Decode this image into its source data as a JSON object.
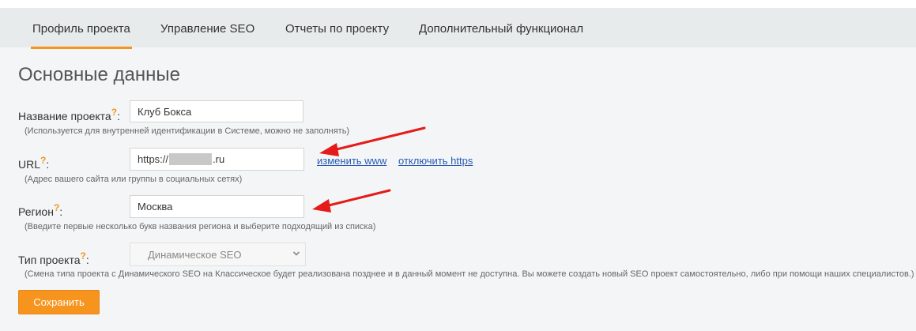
{
  "tabs": [
    {
      "label": "Профиль проекта",
      "active": true
    },
    {
      "label": "Управление SEO",
      "active": false
    },
    {
      "label": "Отчеты по проекту",
      "active": false
    },
    {
      "label": "Дополнительный функционал",
      "active": false
    }
  ],
  "section_title": "Основные данные",
  "help_mark": "?",
  "form": {
    "name": {
      "label": "Название проекта",
      "value": "Клуб Бокса",
      "hint": "(Используется для внутренней идентификации в Системе, можно не заполнять)"
    },
    "url": {
      "label": "URL",
      "value_prefix": "https://",
      "value_suffix": ".ru",
      "hint": "(Адрес вашего сайта или группы в социальных сетях)",
      "links": [
        "изменить www",
        "отключить https"
      ]
    },
    "region": {
      "label": "Регион",
      "value": "Москва",
      "hint": "(Введите первые несколько букв названия региона и выберите подходящий из списка)"
    },
    "type": {
      "label": "Тип проекта",
      "selected": "Динамическое SEO",
      "hint": "(Смена типа проекта с Динамического SEO на Классическое будет реализована позднее и в данный момент не доступна. Вы можете создать новый SEO проект самостоятельно, либо при помощи наших специалистов.)"
    }
  },
  "save_label": "Сохранить",
  "colors": {
    "accent": "#f7941d",
    "link": "#2a5bb3",
    "annotation_arrow": "#e51b1b"
  }
}
